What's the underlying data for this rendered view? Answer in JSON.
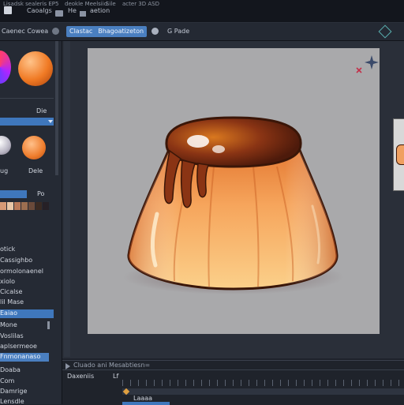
{
  "titlebar": {
    "menu_1": "Lisadsk sealeris EP5",
    "menu_2": "deokle Meelsiid",
    "menu_3": "Sile",
    "menu_4": "acter 3D ASD",
    "tab_1": "Caoalgs",
    "tab_2": "He",
    "tab_3": "aetion"
  },
  "toolbar": {
    "left_label": "Caenec Cowea",
    "active_1": "Clastac",
    "active_2": "Bhagoatizeton",
    "mode": "G Pade"
  },
  "leftpanel": {
    "dropdown_label": "Die",
    "label_a": "ug",
    "label_b": "Dele",
    "select_value": "Po",
    "layers": [
      "otick",
      "Cassighbo",
      "ormolonaenel",
      "xiolo",
      "Cicalse",
      "lil Mase",
      "Eaiao",
      "Mone",
      "Voslilas",
      "aplsermeoe",
      "Fnmonanaso",
      "Doaba",
      "Com",
      "Damrige",
      "Lensdle"
    ]
  },
  "timeline": {
    "header": "Cluado ani Mesabtiesn=",
    "row_label": "Daxeniis",
    "marker": "Lf",
    "track_label": "Laaaa"
  },
  "colors": {
    "accent": "#4a7fc0",
    "panel_bg": "#252a34",
    "canvas_bg": "#a9a9ab",
    "flan_caramel": "#7a2d12",
    "flan_body": "#f2a65a",
    "swatches": [
      "#d69a76",
      "#9c6e50",
      "#6a4a3a",
      "#3a2a22",
      "#262026",
      "#2b2f38",
      "#b97a5a",
      "#e8c7a8"
    ]
  },
  "icons": {
    "sparkle": "sparkle-icon",
    "close": "close-x-icon",
    "home": "home-icon",
    "folder": "folder-icon",
    "play": "play-icon",
    "gear": "gear-icon"
  }
}
